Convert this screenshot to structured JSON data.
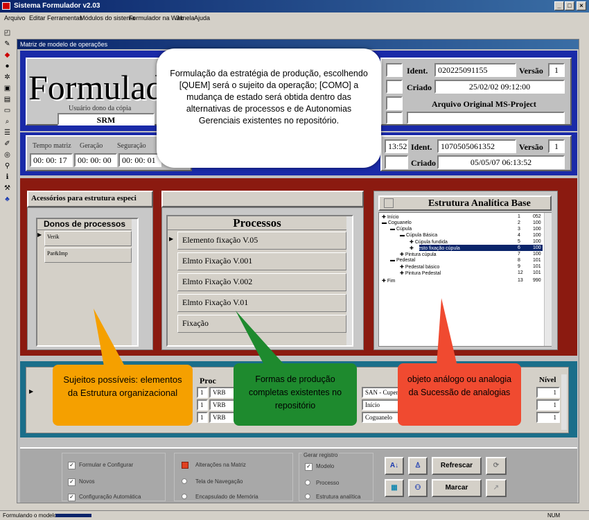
{
  "window": {
    "title": "Sistema Formulador v2.03"
  },
  "menu": [
    "Arquivo",
    "Editar",
    "Ferramentas",
    "Módulos do sistema",
    "Formulador na Web",
    "Janela",
    "Ajuda"
  ],
  "mdi": {
    "title": "Matriz de modelo de operações"
  },
  "header": {
    "logo": "Formulad",
    "usuario_label": "Usuário dono da cópia",
    "usuario_value": "SRM",
    "ident_label": "Ident.",
    "ident_value": "020225091155",
    "versao_label": "Versão",
    "versao_value": "1",
    "criado_label": "Criado",
    "criado_value": "25/02/02 09:12:00",
    "arquivo_label": "Arquivo Original MS-Project"
  },
  "times": {
    "labels": [
      "Tempo matriz",
      "Geração",
      "Seguração"
    ],
    "values": [
      "00: 00: 17",
      "00: 00: 00",
      "00: 00: 01"
    ],
    "partial": "13:52",
    "ident_label": "Ident.",
    "ident_value": "1070505061352",
    "versao_label": "Versão",
    "versao_value": "1",
    "criado_label": "Criado",
    "criado_value": "05/05/07 06:13:52"
  },
  "accessories": {
    "title": "Acessórios para estrutura especi"
  },
  "donos": {
    "header": "Donos de processos",
    "rows": [
      "Verik",
      "Par&Imp"
    ]
  },
  "processos": {
    "header": "Processos",
    "rows": [
      "Elemento fixação V.05",
      "Elmto Fixação V.001",
      "Elmto Fixação V.002",
      "Elmto Fixação V.01",
      "Fixação"
    ]
  },
  "estrutura": {
    "header": "Estrutura Analítica Base",
    "rows": [
      {
        "label": "Início",
        "n": "1",
        "v": "052"
      },
      {
        "label": "Coguanelo",
        "n": "2",
        "v": "100"
      },
      {
        "label": "Cúpula",
        "n": "3",
        "v": "100"
      },
      {
        "label": "Cúpula Básica",
        "n": "4",
        "v": "100"
      },
      {
        "label": "Cúpula fundida",
        "n": "5",
        "v": "100"
      },
      {
        "label": "Cesto fixação cúpula",
        "n": "6",
        "v": "100"
      },
      {
        "label": "Pintura cúpula",
        "n": "7",
        "v": "100"
      },
      {
        "label": "Pedestal",
        "n": "8",
        "v": "101"
      },
      {
        "label": "Pedestal básico",
        "n": "9",
        "v": "101"
      },
      {
        "label": "Pintura Pedestal",
        "n": "12",
        "v": "101"
      },
      {
        "label": "Fim",
        "n": "13",
        "v": "990"
      }
    ]
  },
  "lower_table": {
    "header_partial": "Proc",
    "nivel_label": "Nível",
    "rows": [
      {
        "n": "1",
        "code": "VRB",
        "name": "SAN - Cuper",
        "nivel": "1"
      },
      {
        "n": "1",
        "code": "VRB",
        "name": "Início",
        "nivel": "1"
      },
      {
        "n": "1",
        "code": "VRB",
        "name": "Coguanelo",
        "nivel": "1"
      }
    ]
  },
  "bottom": {
    "checks": [
      "Formular e Configurar",
      "Novos",
      "Configuração Automática"
    ],
    "radios": [
      "Alterações na Matriz",
      "Tela de Navegação",
      "Encapsulado de Memória"
    ],
    "group_title": "Gerar registro",
    "group_items": [
      "Modelo",
      "Processo",
      "Estrutura analítica"
    ],
    "btn_refresh": "Refrescar",
    "btn_mark": "Marcar"
  },
  "status": {
    "left": "Formulando o modelo",
    "right": "NUM"
  },
  "callouts": {
    "top": "Formulação da estratégia de produção, escolhendo [QUEM] será o sujeito da operação; [COMO] a mudança de estado será obtida dentro das alternativas de processos e de Autonomias Gerenciais existentes no repositório.",
    "orange": "Sujeitos possíveis: elementos da Estrutura organizacional",
    "green": "Formas de produção completas existentes no repositório",
    "red": "objeto análogo ou analogia da Sucessão de analogias"
  },
  "colors": {
    "blue_panel": "#1a2aa8",
    "red_panel": "#8b1a10",
    "teal_panel": "#1a6e8a",
    "orange": "#f5a000",
    "green": "#1e8a2e",
    "red_callout": "#f04a30"
  }
}
